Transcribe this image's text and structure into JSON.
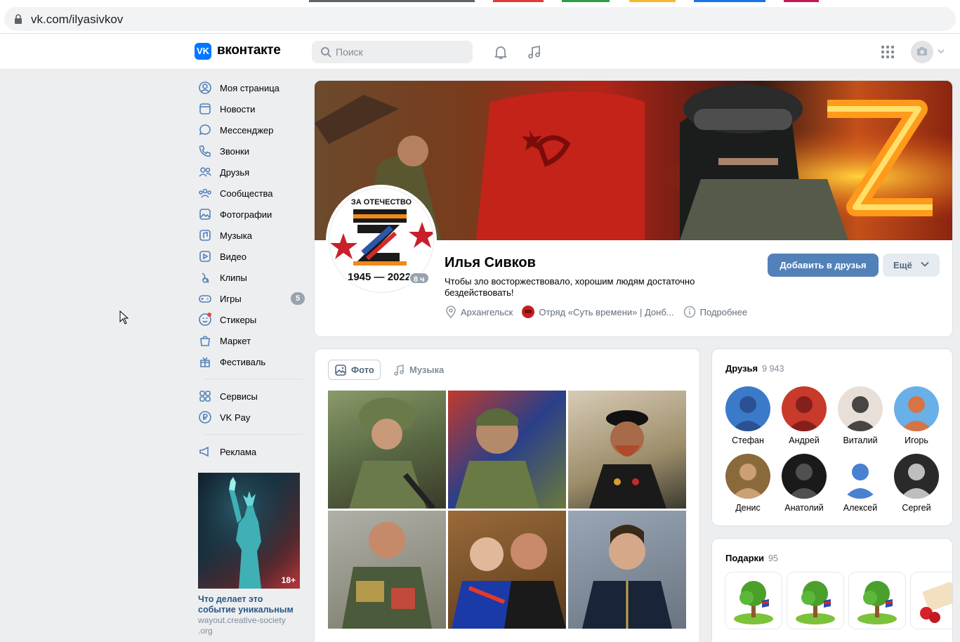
{
  "browser": {
    "url": "vk.com/ilyasivkov"
  },
  "header": {
    "logo_text": "вконтакте",
    "search_placeholder": "Поиск"
  },
  "sidebar": {
    "items": [
      {
        "label": "Моя страница",
        "icon": "user-circle-icon"
      },
      {
        "label": "Новости",
        "icon": "news-icon"
      },
      {
        "label": "Мессенджер",
        "icon": "message-icon"
      },
      {
        "label": "Звонки",
        "icon": "phone-icon"
      },
      {
        "label": "Друзья",
        "icon": "friends-icon"
      },
      {
        "label": "Сообщества",
        "icon": "communities-icon"
      },
      {
        "label": "Фотографии",
        "icon": "photo-icon"
      },
      {
        "label": "Музыка",
        "icon": "music-icon"
      },
      {
        "label": "Видео",
        "icon": "video-icon"
      },
      {
        "label": "Клипы",
        "icon": "clips-icon"
      },
      {
        "label": "Игры",
        "icon": "games-icon",
        "badge": "5"
      },
      {
        "label": "Стикеры",
        "icon": "stickers-icon"
      },
      {
        "label": "Маркет",
        "icon": "market-icon"
      },
      {
        "label": "Фестиваль",
        "icon": "festival-icon"
      }
    ],
    "items2": [
      {
        "label": "Сервисы",
        "icon": "services-icon"
      },
      {
        "label": "VK Pay",
        "icon": "vkpay-icon"
      }
    ],
    "items3": [
      {
        "label": "Реклама",
        "icon": "ads-icon"
      }
    ],
    "ad": {
      "age": "18+",
      "title": "Что делает это событие уникальным",
      "domain": "wayout.creative-society .org"
    }
  },
  "profile": {
    "name": "Илья Сивков",
    "status": "Чтобы зло восторжествовало, хорошим людям достаточно бездействовать!",
    "online": "8 ч",
    "city": "Архангельск",
    "group": "Отряд «Суть времени» | Донб...",
    "more_info": "Подробнее",
    "add_friend": "Добавить в друзья",
    "more": "Ещё",
    "avatar_top": "ЗА ОТЕЧЕСТВО",
    "avatar_bottom": "1945 — 2022"
  },
  "photos": {
    "tabs": [
      {
        "label": "Фото",
        "icon": "photo-icon"
      },
      {
        "label": "Музыка",
        "icon": "music-icon"
      }
    ]
  },
  "friends": {
    "title": "Друзья",
    "count": "9 943",
    "list": [
      {
        "name": "Стефан"
      },
      {
        "name": "Андрей"
      },
      {
        "name": "Виталий"
      },
      {
        "name": "Игорь"
      },
      {
        "name": "Денис"
      },
      {
        "name": "Анатолий"
      },
      {
        "name": "Алексей"
      },
      {
        "name": "Сергей"
      }
    ]
  },
  "gifts": {
    "title": "Подарки",
    "count": "95"
  },
  "colors": {
    "accent": "#5181b8",
    "vk_blue": "#0077ff",
    "page_bg": "#edeef0"
  }
}
